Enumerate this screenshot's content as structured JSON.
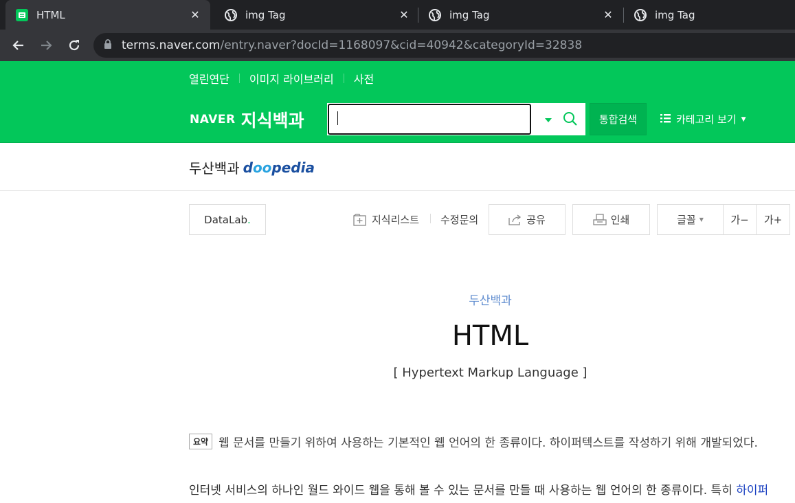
{
  "browser": {
    "tabs": [
      {
        "title": "HTML",
        "icon": "naver-tab-icon",
        "active": true
      },
      {
        "title": "img Tag",
        "icon": "globe-icon",
        "active": false
      },
      {
        "title": "img Tag",
        "icon": "globe-icon",
        "active": false
      },
      {
        "title": "img Tag",
        "icon": "globe-icon",
        "active": false
      }
    ],
    "url_host": "terms.naver.com",
    "url_path": "/entry.naver?docId=1168097&cid=40942&categoryId=32838"
  },
  "gnb": {
    "links": [
      "열린연단",
      "이미지 라이브러리",
      "사전"
    ],
    "brand_naver": "NAVER",
    "brand_kin": "지식백과",
    "search_value": "",
    "search_button": "통합검색",
    "category_view": "카테고리 보기"
  },
  "source": {
    "name_kr": "두산백과",
    "name_en_prefix": "d",
    "name_en_oo": "oo",
    "name_en_suffix": "pedia"
  },
  "utility": {
    "datalab": "DataLab",
    "datalab_dot": ".",
    "knowledge_list": "지식리스트",
    "edit_request": "수정문의",
    "share": "공유",
    "print": "인쇄",
    "font": "글꼴",
    "font_smaller": "가−",
    "font_bigger": "가+"
  },
  "article": {
    "category": "두산백과",
    "title": "HTML",
    "subtitle": "[ Hypertext Markup Language ]",
    "summary_badge": "요약",
    "summary": "웹 문서를 만들기 위하여 사용하는 기본적인 웹 언어의 한 종류이다. 하이퍼텍스트를 작성하기 위해 개발되었다.",
    "body_text": "인터넷 서비스의 하나인 월드 와이드 웹을 통해 볼 수 있는 문서를 만들 때 사용하는 웹 언어의 한 종류이다. 특히 ",
    "body_link": "하이퍼"
  },
  "colors": {
    "naver_green": "#03c75a",
    "link_blue": "#1c42c2",
    "category_blue": "#5f8ccf"
  }
}
